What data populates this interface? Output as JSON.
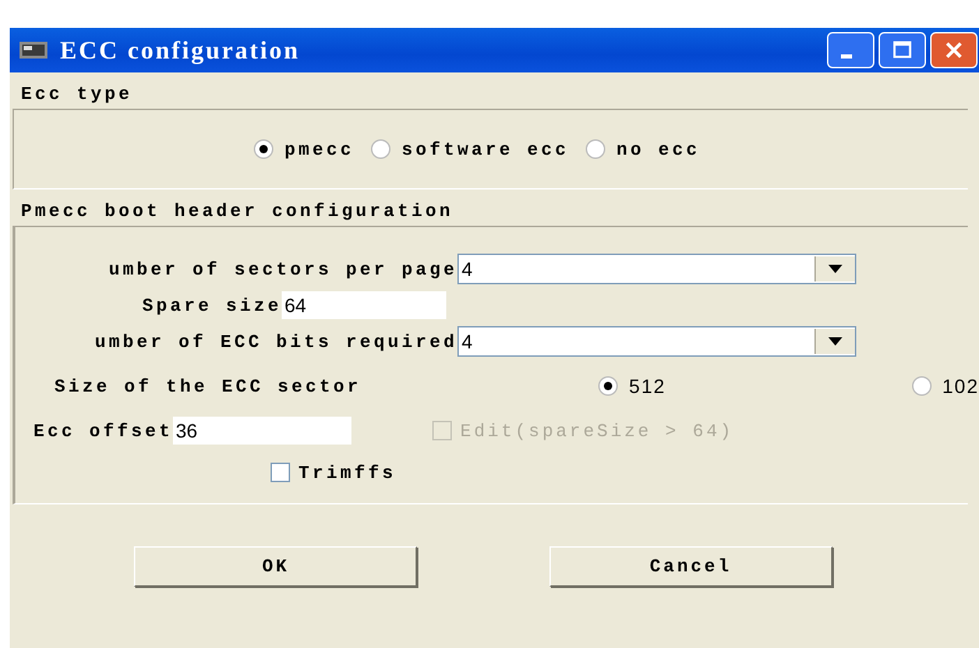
{
  "window": {
    "title": "ECC configuration"
  },
  "ecc_type": {
    "title": "Ecc type",
    "options": [
      {
        "label": "pmecc",
        "selected": true
      },
      {
        "label": "software ecc",
        "selected": false
      },
      {
        "label": "no ecc",
        "selected": false
      }
    ]
  },
  "pmecc": {
    "title": "Pmecc boot header configuration",
    "sectors_per_page": {
      "label": "umber of sectors per page",
      "value": "4"
    },
    "spare_size": {
      "label": "Spare size",
      "value": "64"
    },
    "ecc_bits": {
      "label": "umber of ECC bits required",
      "value": "4"
    },
    "sector_size": {
      "label": "Size of the ECC sector",
      "options": [
        {
          "label": "512",
          "selected": true
        },
        {
          "label": "102",
          "selected": false
        }
      ]
    },
    "ecc_offset": {
      "label": "Ecc offset",
      "value": "36"
    },
    "edit": {
      "label": "Edit(spareSize > 64)",
      "checked": false,
      "disabled": true
    },
    "trimffs": {
      "label": "Trimffs",
      "checked": false,
      "disabled": false
    }
  },
  "buttons": [
    "OK",
    "Cancel"
  ]
}
